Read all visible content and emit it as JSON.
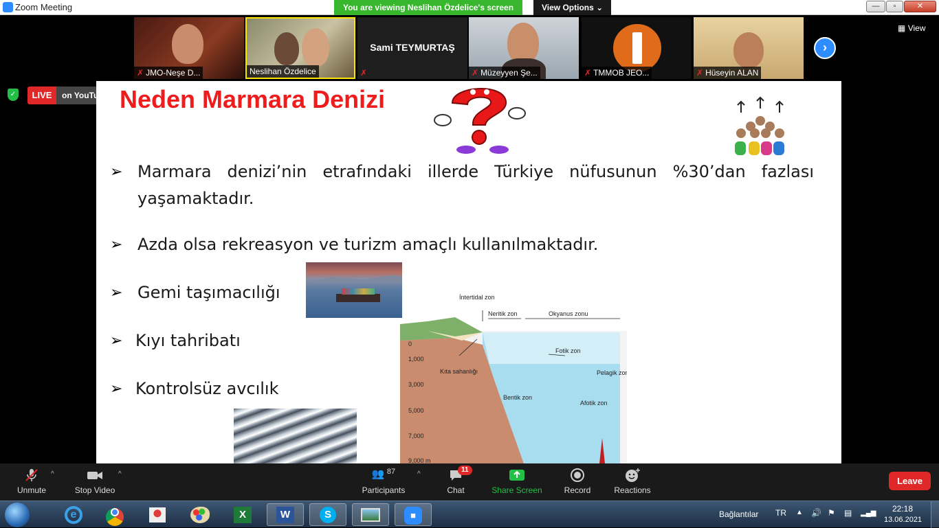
{
  "window": {
    "title": "Zoom Meeting",
    "viewing_banner": "You are viewing Neslihan Özdelice's screen",
    "view_options": "View Options",
    "minimize": "—",
    "maximize": "▫",
    "close": "✕"
  },
  "gallery": {
    "view_label": "View",
    "participants": [
      {
        "name": "JMO-Neşe D...",
        "muted": true
      },
      {
        "name": "Neslihan Özdelice",
        "muted": false,
        "active": true
      },
      {
        "name": "Sami TEYMURTAŞ",
        "muted": true
      },
      {
        "name": "Müzeyyen Şe...",
        "muted": true
      },
      {
        "name": "TMMOB JEO...",
        "muted": true
      },
      {
        "name": "Hüseyin ALAN",
        "muted": true
      }
    ]
  },
  "live": {
    "badge": "LIVE",
    "platform": "on YouTube"
  },
  "slide": {
    "title": "Neden Marmara Denizi",
    "bullets": [
      "Marmara denizi’nin etrafındaki illerde Türkiye nüfusunun %30’dan fazlası",
      "yaşamaktadır.",
      "Azda olsa rekreasyon ve turizm amaçlı kullanılmaktadır.",
      "Gemi taşımacılığı",
      "Kıyı tahribatı",
      "Kontrolsüz avcılık"
    ],
    "diagram": {
      "labels": [
        "İntertidal zon",
        "Neritik zon",
        "Okyanus zonu",
        "Kıta sahanlığı",
        "Fotik zon",
        "Pelagik zon",
        "Bentik zon",
        "Afotik zon"
      ],
      "depths": [
        "0",
        "1,000",
        "3,000",
        "5,000",
        "7,000",
        "9,000 m"
      ]
    }
  },
  "toolbar": {
    "unmute": "Unmute",
    "stop_video": "Stop Video",
    "participants_label": "Participants",
    "participants_count": "87",
    "chat": "Chat",
    "chat_badge": "11",
    "share_screen": "Share Screen",
    "record": "Record",
    "reactions": "Reactions",
    "leave": "Leave"
  },
  "taskbar": {
    "connections": "Bağlantılar",
    "language": "TR",
    "time": "22:18",
    "date": "13.06.2021"
  },
  "colors": {
    "accent_blue": "#2d8cff",
    "live_red": "#e02828",
    "share_green": "#23c048",
    "slide_title_red": "#ee1c1c"
  }
}
